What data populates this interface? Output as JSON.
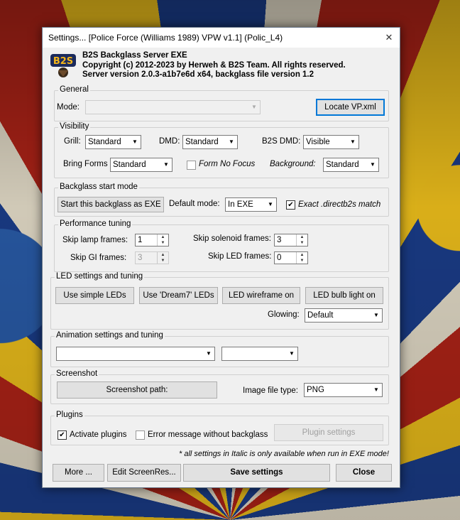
{
  "window": {
    "title": "Settings... [Police Force (Williams 1989) VPW v1.1]  (Polic_L4)",
    "close": "✕"
  },
  "header": {
    "logo": "B2S",
    "line1": "B2S Backglass Server EXE",
    "line2": "Copyright (c) 2012-2023 by Herweh & B2S Team. All rights reserved.",
    "line3": "Server version 2.0.3-a1b7e6d x64, backglass file version 1.2"
  },
  "general": {
    "title": "General",
    "mode_label": "Mode:",
    "mode_value": "",
    "locate_button": "Locate VP.xml"
  },
  "visibility": {
    "title": "Visibility",
    "grill_label": "Grill:",
    "grill_value": "Standard",
    "dmd_label": "DMD:",
    "dmd_value": "Standard",
    "b2sdmd_label": "B2S DMD:",
    "b2sdmd_value": "Visible",
    "bringforms_label": "Bring Forms",
    "bringforms_value": "Standard",
    "formnofocus_label": "Form No Focus",
    "background_label": "Background:",
    "background_value": "Standard"
  },
  "backglass": {
    "title": "Backglass start mode",
    "start_button": "Start this backglass as EXE",
    "default_mode_label": "Default mode:",
    "default_mode_value": "In EXE",
    "exact_label": "Exact .directb2s match",
    "exact_checked": "✔"
  },
  "performance": {
    "title": "Performance tuning",
    "skip_lamp_label": "Skip lamp frames:",
    "skip_lamp_value": "1",
    "skip_solenoid_label": "Skip solenoid frames:",
    "skip_solenoid_value": "3",
    "skip_gi_label": "Skip GI frames:",
    "skip_gi_value": "3",
    "skip_led_label": "Skip LED frames:",
    "skip_led_value": "0"
  },
  "led": {
    "title": "LED settings and tuning",
    "simple_button": "Use simple LEDs",
    "dream7_button": "Use 'Dream7' LEDs",
    "wireframe_button": "LED wireframe on",
    "bulb_button": "LED bulb light on",
    "glowing_label": "Glowing:",
    "glowing_value": "Default"
  },
  "animation": {
    "title": "Animation settings and tuning",
    "select1_value": "",
    "select2_value": ""
  },
  "screenshot": {
    "title": "Screenshot",
    "path_button": "Screenshot path:",
    "filetype_label": "Image file type:",
    "filetype_value": "PNG"
  },
  "plugins": {
    "title": "Plugins",
    "activate_label": "Activate plugins",
    "activate_checked": "✔",
    "error_label": "Error message without backglass",
    "settings_button": "Plugin settings"
  },
  "footer": {
    "note": "* all settings in Italic is only available when run in EXE mode!",
    "more_button": "More ...",
    "edit_button": "Edit ScreenRes...",
    "save_button": "Save settings",
    "close_button": "Close"
  },
  "icons": {
    "dropdown": "▼",
    "spin_up": "▲",
    "spin_down": "▼"
  }
}
